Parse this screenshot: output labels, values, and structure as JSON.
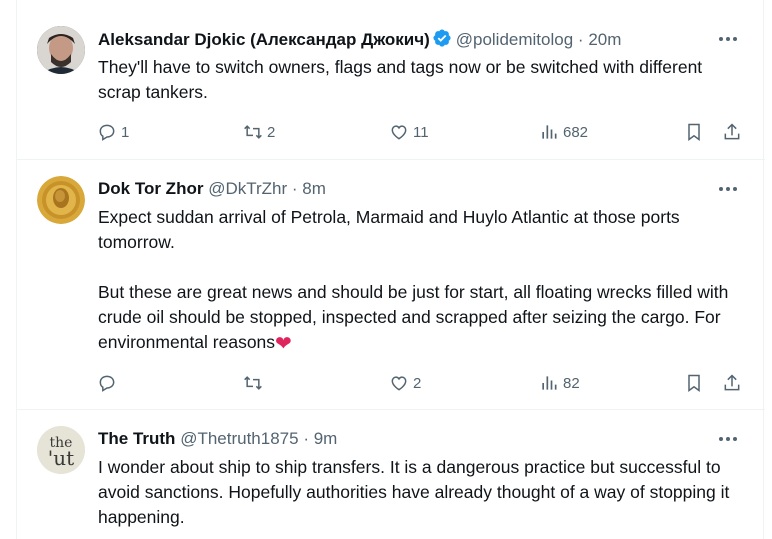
{
  "tweets": [
    {
      "name": "Aleksandar Djokic (Александар Джокич)",
      "handle": "@polidemitolog",
      "time": "20m",
      "verified": true,
      "text": "They'll have to switch owners, flags and tags now or be switched with different scrap tankers.",
      "replies": "1",
      "retweets": "2",
      "likes": "11",
      "views": "682"
    },
    {
      "name": "Dok Tor Zhor",
      "handle": "@DkTrZhr",
      "time": "8m",
      "verified": false,
      "text": "Expect suddan arrival of Petrola, Marmaid and Huylo Atlantic at those ports tomorrow.\n\nBut these are great news and should be just for start, all floating wrecks filled with crude oil should be stopped, inspected and scrapped after seizing the cargo. For environmental reasons",
      "emoji": "❤",
      "replies": "",
      "retweets": "",
      "likes": "2",
      "views": "82"
    },
    {
      "name": "The Truth",
      "handle": "@Thetruth1875",
      "time": "9m",
      "verified": false,
      "text": "I wonder about ship to ship transfers. It is a dangerous practice but successful to avoid sanctions. Hopefully authorities have already thought of a way of stopping it happening.",
      "avatar_text": "the 'ut"
    }
  ],
  "separator": "·",
  "colors": {
    "accent": "#1d9bf0",
    "secondary": "#536471",
    "text": "#0f1419",
    "border": "#eff3f4",
    "like": "#e0245e"
  }
}
